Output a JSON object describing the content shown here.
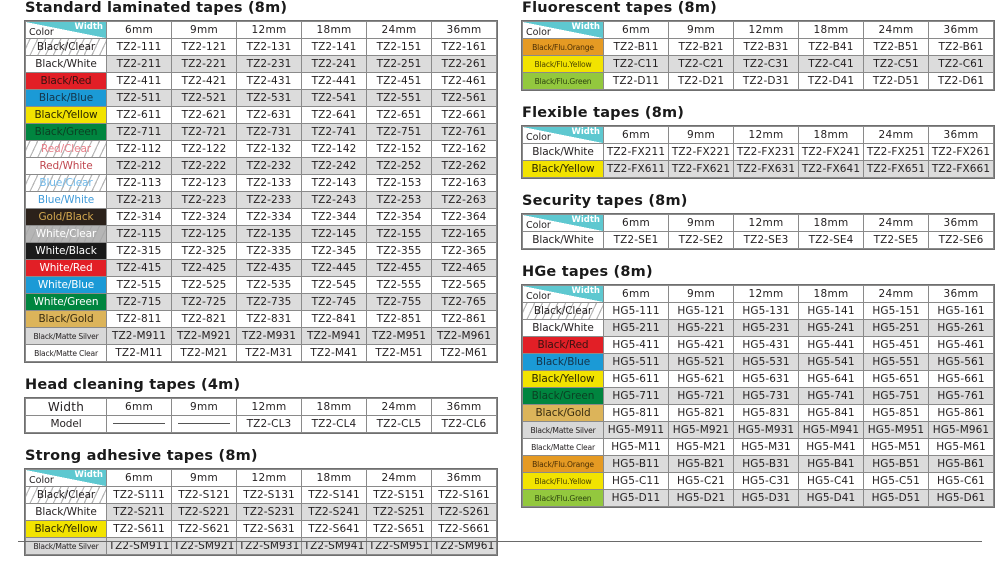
{
  "corner": {
    "color_label": "Color",
    "width_label": "Width"
  },
  "widths": [
    "6mm",
    "9mm",
    "12mm",
    "18mm",
    "24mm",
    "36mm"
  ],
  "colors": {
    "teal": "#5ec8d0",
    "alt_row": "#dcdcdc",
    "grid": "#8a8a8a",
    "text": "#231f20"
  },
  "sections": [
    {
      "id": "standard-laminated-tapes",
      "title": "Standard laminated tapes (8m)",
      "column": "left",
      "first_header": "corner",
      "rows": [
        {
          "color": "Black/Clear",
          "style": "clear",
          "models": [
            "TZ2-111",
            "TZ2-121",
            "TZ2-131",
            "TZ2-141",
            "TZ2-151",
            "TZ2-161"
          ]
        },
        {
          "color": "Black/White",
          "style": "white",
          "models": [
            "TZ2-211",
            "TZ2-221",
            "TZ2-231",
            "TZ2-241",
            "TZ2-251",
            "TZ2-261"
          ]
        },
        {
          "color": "Black/Red",
          "style": "red",
          "models": [
            "TZ2-411",
            "TZ2-421",
            "TZ2-431",
            "TZ2-441",
            "TZ2-451",
            "TZ2-461"
          ]
        },
        {
          "color": "Black/Blue",
          "style": "blue",
          "models": [
            "TZ2-511",
            "TZ2-521",
            "TZ2-531",
            "TZ2-541",
            "TZ2-551",
            "TZ2-561"
          ]
        },
        {
          "color": "Black/Yellow",
          "style": "yellow",
          "models": [
            "TZ2-611",
            "TZ2-621",
            "TZ2-631",
            "TZ2-641",
            "TZ2-651",
            "TZ2-661"
          ]
        },
        {
          "color": "Black/Green",
          "style": "green",
          "models": [
            "TZ2-711",
            "TZ2-721",
            "TZ2-731",
            "TZ2-741",
            "TZ2-751",
            "TZ2-761"
          ]
        },
        {
          "color": "Red/Clear",
          "style": "clear-red",
          "models": [
            "TZ2-112",
            "TZ2-122",
            "TZ2-132",
            "TZ2-142",
            "TZ2-152",
            "TZ2-162"
          ]
        },
        {
          "color": "Red/White",
          "style": "white-red",
          "models": [
            "TZ2-212",
            "TZ2-222",
            "TZ2-232",
            "TZ2-242",
            "TZ2-252",
            "TZ2-262"
          ]
        },
        {
          "color": "Blue/Clear",
          "style": "clear-blue",
          "models": [
            "TZ2-113",
            "TZ2-123",
            "TZ2-133",
            "TZ2-143",
            "TZ2-153",
            "TZ2-163"
          ]
        },
        {
          "color": "Blue/White",
          "style": "white-blue",
          "models": [
            "TZ2-213",
            "TZ2-223",
            "TZ2-233",
            "TZ2-243",
            "TZ2-253",
            "TZ2-263"
          ]
        },
        {
          "color": "Gold/Black",
          "style": "black-gold",
          "models": [
            "TZ2-314",
            "TZ2-324",
            "TZ2-334",
            "TZ2-344",
            "TZ2-354",
            "TZ2-364"
          ]
        },
        {
          "color": "White/Clear",
          "style": "clear-white",
          "models": [
            "TZ2-115",
            "TZ2-125",
            "TZ2-135",
            "TZ2-145",
            "TZ2-155",
            "TZ2-165"
          ]
        },
        {
          "color": "White/Black",
          "style": "black-white",
          "models": [
            "TZ2-315",
            "TZ2-325",
            "TZ2-335",
            "TZ2-345",
            "TZ2-355",
            "TZ2-365"
          ]
        },
        {
          "color": "White/Red",
          "style": "red-white",
          "models": [
            "TZ2-415",
            "TZ2-425",
            "TZ2-435",
            "TZ2-445",
            "TZ2-455",
            "TZ2-465"
          ]
        },
        {
          "color": "White/Blue",
          "style": "blue-white",
          "models": [
            "TZ2-515",
            "TZ2-525",
            "TZ2-535",
            "TZ2-545",
            "TZ2-555",
            "TZ2-565"
          ]
        },
        {
          "color": "White/Green",
          "style": "green-white",
          "models": [
            "TZ2-715",
            "TZ2-725",
            "TZ2-735",
            "TZ2-745",
            "TZ2-755",
            "TZ2-765"
          ]
        },
        {
          "color": "Black/Gold",
          "style": "gold",
          "models": [
            "TZ2-811",
            "TZ2-821",
            "TZ2-831",
            "TZ2-841",
            "TZ2-851",
            "TZ2-861"
          ]
        },
        {
          "color": "Black/Matte Silver",
          "style": "matte-silver",
          "small": true,
          "models": [
            "TZ2-M911",
            "TZ2-M921",
            "TZ2-M931",
            "TZ2-M941",
            "TZ2-M951",
            "TZ2-M961"
          ]
        },
        {
          "color": "Black/Matte Clear",
          "style": "matte-clear",
          "small": true,
          "models": [
            "TZ2-M11",
            "TZ2-M21",
            "TZ2-M31",
            "TZ2-M41",
            "TZ2-M51",
            "TZ2-M61"
          ]
        }
      ]
    },
    {
      "id": "head-cleaning-tapes",
      "title": "Head cleaning tapes (4m)",
      "column": "left",
      "first_header": "width",
      "first_header_label": "Width",
      "rows": [
        {
          "color": "Model",
          "style": "white",
          "plain_label": true,
          "models": [
            "—",
            "—",
            "TZ2-CL3",
            "TZ2-CL4",
            "TZ2-CL5",
            "TZ2-CL6"
          ]
        }
      ]
    },
    {
      "id": "strong-adhesive-tapes",
      "title": "Strong adhesive tapes (8m)",
      "column": "left",
      "first_header": "corner",
      "rows": [
        {
          "color": "Black/Clear",
          "style": "clear",
          "models": [
            "TZ2-S111",
            "TZ2-S121",
            "TZ2-S131",
            "TZ2-S141",
            "TZ2-S151",
            "TZ2-S161"
          ]
        },
        {
          "color": "Black/White",
          "style": "white",
          "models": [
            "TZ2-S211",
            "TZ2-S221",
            "TZ2-S231",
            "TZ2-S241",
            "TZ2-S251",
            "TZ2-S261"
          ]
        },
        {
          "color": "Black/Yellow",
          "style": "yellow",
          "models": [
            "TZ2-S611",
            "TZ2-S621",
            "TZ2-S631",
            "TZ2-S641",
            "TZ2-S651",
            "TZ2-S661"
          ]
        },
        {
          "color": "Black/Matte Silver",
          "style": "matte-silver",
          "small": true,
          "models": [
            "TZ2-SM911",
            "TZ2-SM921",
            "TZ2-SM931",
            "TZ2-SM941",
            "TZ2-SM951",
            "TZ2-SM961"
          ]
        }
      ]
    },
    {
      "id": "fluorescent-tapes",
      "title": "Fluorescent tapes (8m)",
      "column": "right",
      "first_header": "corner",
      "rows": [
        {
          "color": "Black/Flu.Orange",
          "style": "flu-orange",
          "small": true,
          "models": [
            "TZ2-B11",
            "TZ2-B21",
            "TZ2-B31",
            "TZ2-B41",
            "TZ2-B51",
            "TZ2-B61"
          ]
        },
        {
          "color": "Black/Flu.Yellow",
          "style": "flu-yellow",
          "small": true,
          "models": [
            "TZ2-C11",
            "TZ2-C21",
            "TZ2-C31",
            "TZ2-C41",
            "TZ2-C51",
            "TZ2-C61"
          ]
        },
        {
          "color": "Black/Flu.Green",
          "style": "flu-green",
          "small": true,
          "models": [
            "TZ2-D11",
            "TZ2-D21",
            "TZ2-D31",
            "TZ2-D41",
            "TZ2-D51",
            "TZ2-D61"
          ]
        }
      ]
    },
    {
      "id": "flexible-tapes",
      "title": "Flexible tapes (8m)",
      "column": "right",
      "first_header": "corner",
      "rows": [
        {
          "color": "Black/White",
          "style": "white",
          "models": [
            "TZ2-FX211",
            "TZ2-FX221",
            "TZ2-FX231",
            "TZ2-FX241",
            "TZ2-FX251",
            "TZ2-FX261"
          ]
        },
        {
          "color": "Black/Yellow",
          "style": "yellow",
          "models": [
            "TZ2-FX611",
            "TZ2-FX621",
            "TZ2-FX631",
            "TZ2-FX641",
            "TZ2-FX651",
            "TZ2-FX661"
          ]
        }
      ]
    },
    {
      "id": "security-tapes",
      "title": "Security tapes (8m)",
      "column": "right",
      "first_header": "corner",
      "rows": [
        {
          "color": "Black/White",
          "style": "white",
          "models": [
            "TZ2-SE1",
            "TZ2-SE2",
            "TZ2-SE3",
            "TZ2-SE4",
            "TZ2-SE5",
            "TZ2-SE6"
          ]
        }
      ]
    },
    {
      "id": "hge-tapes",
      "title": "HGe tapes (8m)",
      "column": "right",
      "first_header": "corner",
      "rows": [
        {
          "color": "Black/Clear",
          "style": "clear",
          "models": [
            "HG5-111",
            "HG5-121",
            "HG5-131",
            "HG5-141",
            "HG5-151",
            "HG5-161"
          ]
        },
        {
          "color": "Black/White",
          "style": "white",
          "models": [
            "HG5-211",
            "HG5-221",
            "HG5-231",
            "HG5-241",
            "HG5-251",
            "HG5-261"
          ]
        },
        {
          "color": "Black/Red",
          "style": "red",
          "models": [
            "HG5-411",
            "HG5-421",
            "HG5-431",
            "HG5-441",
            "HG5-451",
            "HG5-461"
          ]
        },
        {
          "color": "Black/Blue",
          "style": "blue",
          "models": [
            "HG5-511",
            "HG5-521",
            "HG5-531",
            "HG5-541",
            "HG5-551",
            "HG5-561"
          ]
        },
        {
          "color": "Black/Yellow",
          "style": "yellow",
          "models": [
            "HG5-611",
            "HG5-621",
            "HG5-631",
            "HG5-641",
            "HG5-651",
            "HG5-661"
          ]
        },
        {
          "color": "Black/Green",
          "style": "green",
          "models": [
            "HG5-711",
            "HG5-721",
            "HG5-731",
            "HG5-741",
            "HG5-751",
            "HG5-761"
          ]
        },
        {
          "color": "Black/Gold",
          "style": "gold",
          "models": [
            "HG5-811",
            "HG5-821",
            "HG5-831",
            "HG5-841",
            "HG5-851",
            "HG5-861"
          ]
        },
        {
          "color": "Black/Matte Silver",
          "style": "matte-silver",
          "small": true,
          "models": [
            "HG5-M911",
            "HG5-M921",
            "HG5-M931",
            "HG5-M941",
            "HG5-M951",
            "HG5-M961"
          ]
        },
        {
          "color": "Black/Matte Clear",
          "style": "matte-clear",
          "small": true,
          "models": [
            "HG5-M11",
            "HG5-M21",
            "HG5-M31",
            "HG5-M41",
            "HG5-M51",
            "HG5-M61"
          ]
        },
        {
          "color": "Black/Flu.Orange",
          "style": "flu-orange",
          "small": true,
          "models": [
            "HG5-B11",
            "HG5-B21",
            "HG5-B31",
            "HG5-B41",
            "HG5-B51",
            "HG5-B61"
          ]
        },
        {
          "color": "Black/Flu.Yellow",
          "style": "flu-yellow",
          "small": true,
          "models": [
            "HG5-C11",
            "HG5-C21",
            "HG5-C31",
            "HG5-C41",
            "HG5-C51",
            "HG5-C61"
          ]
        },
        {
          "color": "Black/Flu.Green",
          "style": "flu-green",
          "small": true,
          "models": [
            "HG5-D11",
            "HG5-D21",
            "HG5-D31",
            "HG5-D41",
            "HG5-D51",
            "HG5-D61"
          ]
        }
      ]
    }
  ]
}
